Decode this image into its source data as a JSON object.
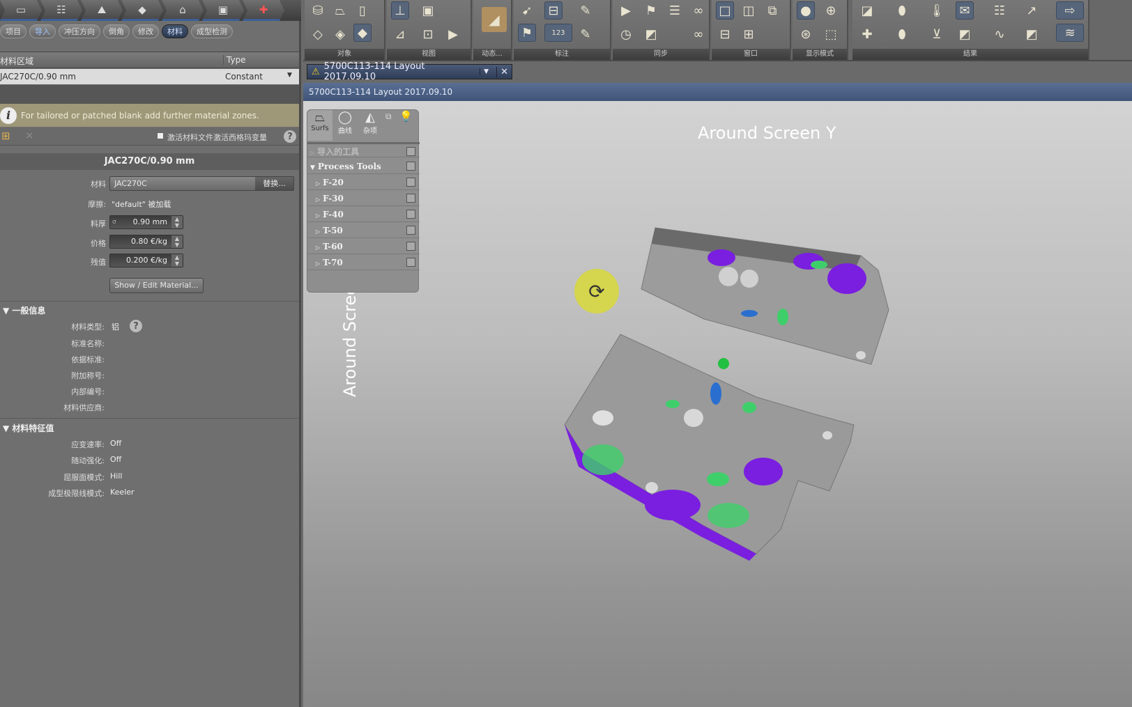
{
  "workflow": {
    "steps": [
      "start",
      "structure",
      "die",
      "blank",
      "press",
      "code",
      "check"
    ]
  },
  "process_tabs": [
    "项目",
    "导入",
    "冲压方向",
    "倒角",
    "修改",
    "材料",
    "成型检测"
  ],
  "active_process_tab": "材料",
  "zones_table": {
    "headers": [
      "材料区域",
      "Type"
    ],
    "rows": [
      {
        "zone": "JAC270C/0.90 mm",
        "type": "Constant"
      }
    ]
  },
  "info_message": "For tailored or patched blank add further material zones.",
  "activate_checkbox": {
    "label": "激活材料文件激活西格玛变量",
    "checked": false
  },
  "material": {
    "title": "JAC270C/0.90 mm",
    "material_label": "材料",
    "material_value": "JAC270C",
    "replace_button": "替换...",
    "friction_label": "摩擦:",
    "friction_value": "\"default\" 被加载",
    "thickness_label": "料厚",
    "thickness_value": "0.90 mm",
    "thickness_prefix": "σ",
    "price_label": "价格",
    "price_value": "0.80 €/kg",
    "scrap_label": "残值",
    "scrap_value": "0.200 €/kg",
    "show_edit_button": "Show / Edit Material..."
  },
  "general_info": {
    "title": "一般信息",
    "rows": [
      {
        "label": "材料类型:",
        "value": "铝"
      },
      {
        "label": "标准名称:",
        "value": ""
      },
      {
        "label": "依据标准:",
        "value": ""
      },
      {
        "label": "附加称号:",
        "value": ""
      },
      {
        "label": "内部编号:",
        "value": ""
      },
      {
        "label": "材料供应商:",
        "value": ""
      }
    ]
  },
  "material_props": {
    "title": "材料特征值",
    "rows": [
      {
        "label": "应变速率:",
        "value": "Off"
      },
      {
        "label": "随动强化:",
        "value": "Off"
      },
      {
        "label": "屈服面模式:",
        "value": "Hill"
      },
      {
        "label": "成型极限线模式:",
        "value": "Keeler"
      }
    ]
  },
  "ribbon_groups": [
    "对象",
    "视图",
    "动态...",
    "标注",
    "同步",
    "窗口",
    "显示模式",
    "结果"
  ],
  "document_tab": {
    "title": "5700C113-114 Layout  2017.09.10",
    "warning": true
  },
  "document_title": "5700C113-114 Layout  2017.09.10",
  "tool_panel": {
    "tabs": [
      "Surfs",
      "曲线",
      "杂项"
    ],
    "imported": "导入的工具",
    "group": "Process Tools",
    "items": [
      "F-20",
      "F-30",
      "F-40",
      "T-50",
      "T-60",
      "T-70"
    ]
  },
  "viewport": {
    "rotate_y_label": "Around Screen Y",
    "rotate_z_label": "Around Screen Z"
  },
  "colors": {
    "accent": "#3f5478",
    "highlight_violet": "#7a1ee0",
    "highlight_green": "#3fcf6a",
    "highlight_blue": "#2a6fd0",
    "rotate_marker": "#d8d83a"
  }
}
